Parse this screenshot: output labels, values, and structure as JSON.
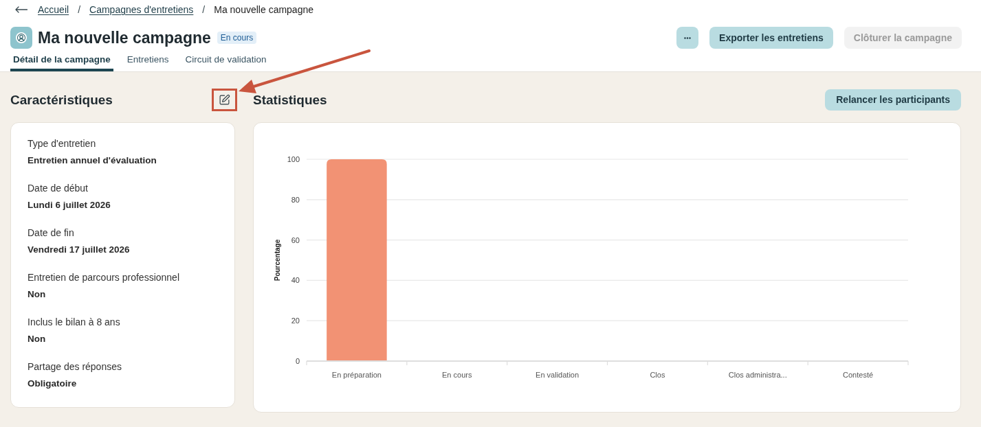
{
  "breadcrumb": [
    {
      "kind": "link",
      "label": "Accueil"
    },
    {
      "kind": "separator",
      "label": "/"
    },
    {
      "kind": "link",
      "label": "Campagnes d'entretiens"
    },
    {
      "kind": "separator",
      "label": "/"
    },
    {
      "kind": "current",
      "label": "Ma nouvelle campagne"
    }
  ],
  "header": {
    "title": "Ma nouvelle campagne",
    "status": "En cours",
    "actions": [
      {
        "label": "Exporter les entretiens",
        "disabled": false
      },
      {
        "label": "Clôturer la campagne",
        "disabled": true
      }
    ]
  },
  "tabs": [
    {
      "label": "Détail de la campagne",
      "selected": true
    },
    {
      "label": "Entretiens",
      "selected": false
    },
    {
      "label": "Circuit de validation",
      "selected": false
    }
  ],
  "characteristics": {
    "title": "Caractéristiques",
    "edit_highlighted": true,
    "fields": [
      {
        "label": "Type d'entretien",
        "value": "Entretien annuel d'évaluation"
      },
      {
        "label": "Date de début",
        "value": "Lundi 6 juillet 2026"
      },
      {
        "label": "Date de fin",
        "value": "Vendredi 17 juillet 2026"
      },
      {
        "label": "Entretien de parcours professionnel",
        "value": "Non"
      },
      {
        "label": "Inclus le bilan à 8 ans",
        "value": "Non"
      },
      {
        "label": "Partage des réponses",
        "value": "Obligatoire"
      }
    ]
  },
  "statistics": {
    "title": "Statistiques",
    "action": "Relancer les participants",
    "chart_data": {
      "type": "bar",
      "ylabel": "Pourcentage",
      "categories": [
        "En préparation",
        "En cours",
        "En validation",
        "Clos",
        "Clos administra...",
        "Contesté"
      ],
      "values": [
        100,
        0,
        0,
        0,
        0,
        0
      ],
      "ylim": [
        0,
        100
      ],
      "yticks": [
        0,
        20,
        40,
        60,
        80,
        100
      ],
      "grid": true
    }
  }
}
